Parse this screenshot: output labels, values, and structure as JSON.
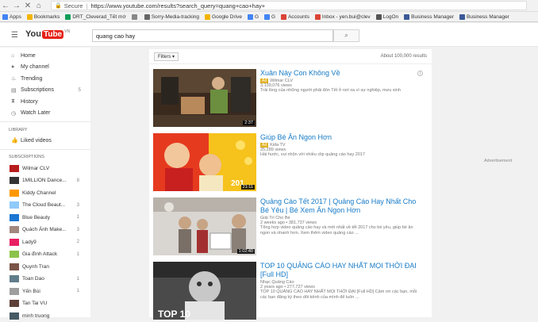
{
  "browser": {
    "secure_label": "Secure",
    "url": "https://www.youtube.com/results?search_query=quang+cao+hay+",
    "bookmarks": [
      {
        "label": "Apps",
        "color": "#4285f4"
      },
      {
        "label": "Bookmarks",
        "color": "#f4b400"
      },
      {
        "label": "DRT_Cleverad_Tết mớ",
        "color": "#0f9d58"
      },
      {
        "label": "",
        "color": "#888888"
      },
      {
        "label": "Sorry-Media-tracking",
        "color": "#666666"
      },
      {
        "label": "Google Drive",
        "color": "#f4b400"
      },
      {
        "label": "G",
        "color": "#4285f4"
      },
      {
        "label": "G",
        "color": "#4285f4"
      },
      {
        "label": "Accounts",
        "color": "#db4437"
      },
      {
        "label": "Inbox - yen.bui@clev",
        "color": "#db4437"
      },
      {
        "label": "LogOn",
        "color": "#555555"
      },
      {
        "label": "Business Manager",
        "color": "#3b5998"
      },
      {
        "label": "Business Manager",
        "color": "#3b5998"
      }
    ]
  },
  "header": {
    "logo_you": "You",
    "logo_tube": "Tube",
    "logo_region": "VN",
    "search_value": "quang cao hay"
  },
  "sidebar": {
    "nav": [
      {
        "label": "Home",
        "icon": "home-icon",
        "glyph": "⌂",
        "count": ""
      },
      {
        "label": "My channel",
        "icon": "person-icon",
        "glyph": "●",
        "count": ""
      },
      {
        "label": "Trending",
        "icon": "flame-icon",
        "glyph": "♨",
        "count": ""
      },
      {
        "label": "Subscriptions",
        "icon": "subscriptions-icon",
        "glyph": "▤",
        "count": "5"
      },
      {
        "label": "History",
        "icon": "history-icon",
        "glyph": "⧗",
        "count": ""
      },
      {
        "label": "Watch Later",
        "icon": "clock-icon",
        "glyph": "◷",
        "count": ""
      }
    ],
    "library_heading": "LIBRARY",
    "library": [
      {
        "label": "Liked videos",
        "icon": "thumbs-up-icon",
        "glyph": "👍"
      }
    ],
    "subscriptions_heading": "SUBSCRIPTIONS",
    "subscriptions": [
      {
        "label": "Wilmar CLV",
        "count": "",
        "color": "#b71c1c"
      },
      {
        "label": "1MILLION Dance...",
        "count": "8",
        "color": "#333333"
      },
      {
        "label": "Kiddy Channel",
        "count": "",
        "color": "#ff9800"
      },
      {
        "label": "The Cloud Beaut...",
        "count": "3",
        "color": "#90caf9"
      },
      {
        "label": "Blue Beauty",
        "count": "1",
        "color": "#1976d2"
      },
      {
        "label": "Quách Ánh Make...",
        "count": "3",
        "color": "#a1887f"
      },
      {
        "label": "Lady9",
        "count": "2",
        "color": "#e91e63"
      },
      {
        "label": "Gia đình Attack",
        "count": "1",
        "color": "#8bc34a"
      },
      {
        "label": "Quynh Tran",
        "count": "",
        "color": "#795548"
      },
      {
        "label": "Toan Dao",
        "count": "1",
        "color": "#607d8b"
      },
      {
        "label": "Yến Bùi",
        "count": "1",
        "color": "#9e9e9e"
      },
      {
        "label": "Tan Tai VU",
        "count": "",
        "color": "#5d4037"
      },
      {
        "label": "minh truong",
        "count": "",
        "color": "#455a64"
      }
    ]
  },
  "results": {
    "filters_label": "Filters ▾",
    "about": "About 100,000 results",
    "items": [
      {
        "title": "Xuân Này Con Không Về",
        "ad": "Ad",
        "channel": "Wilmar CLV",
        "views": "3,139,076 views",
        "desc": "Trải lòng của những người phải đón Tết ở nơi xa vì sự nghiệp, mưu sinh",
        "duration": "2:37"
      },
      {
        "title": "Giúp Bé Ăn Ngon Hơn",
        "ad": "Ad",
        "channel": "Kida TV",
        "views": "25,289 views",
        "desc": "Hài hước, vui nhộn với nhiều clip quảng cáo hay 2017",
        "duration": "21:11"
      },
      {
        "title": "Quảng Cáo Tết 2017 | Quảng Cáo Hay Nhất Cho Bé Yêu | Bé Xem Ăn Ngon Hơn",
        "ad": "",
        "channel": "Giải Trí Cho Bé",
        "views": "2 weeks ago  •  381,737 views",
        "desc": "Tổng hợp video quảng cáo hay và mới nhất về tết 2017 cho bé yêu, giúp bé ăn ngon và nhanh hơn. Xem thêm video quảng cáo ...",
        "duration": "1:02:40"
      },
      {
        "title": "TOP 10 QUẢNG CÁO HAY NHẤT MỌI THỜI ĐẠI [Full HD]",
        "ad": "",
        "channel": "Nhạc Quảng Cáo",
        "views": "2 years ago  •  277,727 views",
        "desc": "TOP 10 QUẢNG CÁO HAY NHẤT MỌI THỜI ĐẠI [Full HD] Cảm ơn các bạn, mỗi các bạn đăng ký theo dõi kênh của mình để luôn ...",
        "duration": ""
      }
    ]
  },
  "advertisement_label": "Advertisement"
}
